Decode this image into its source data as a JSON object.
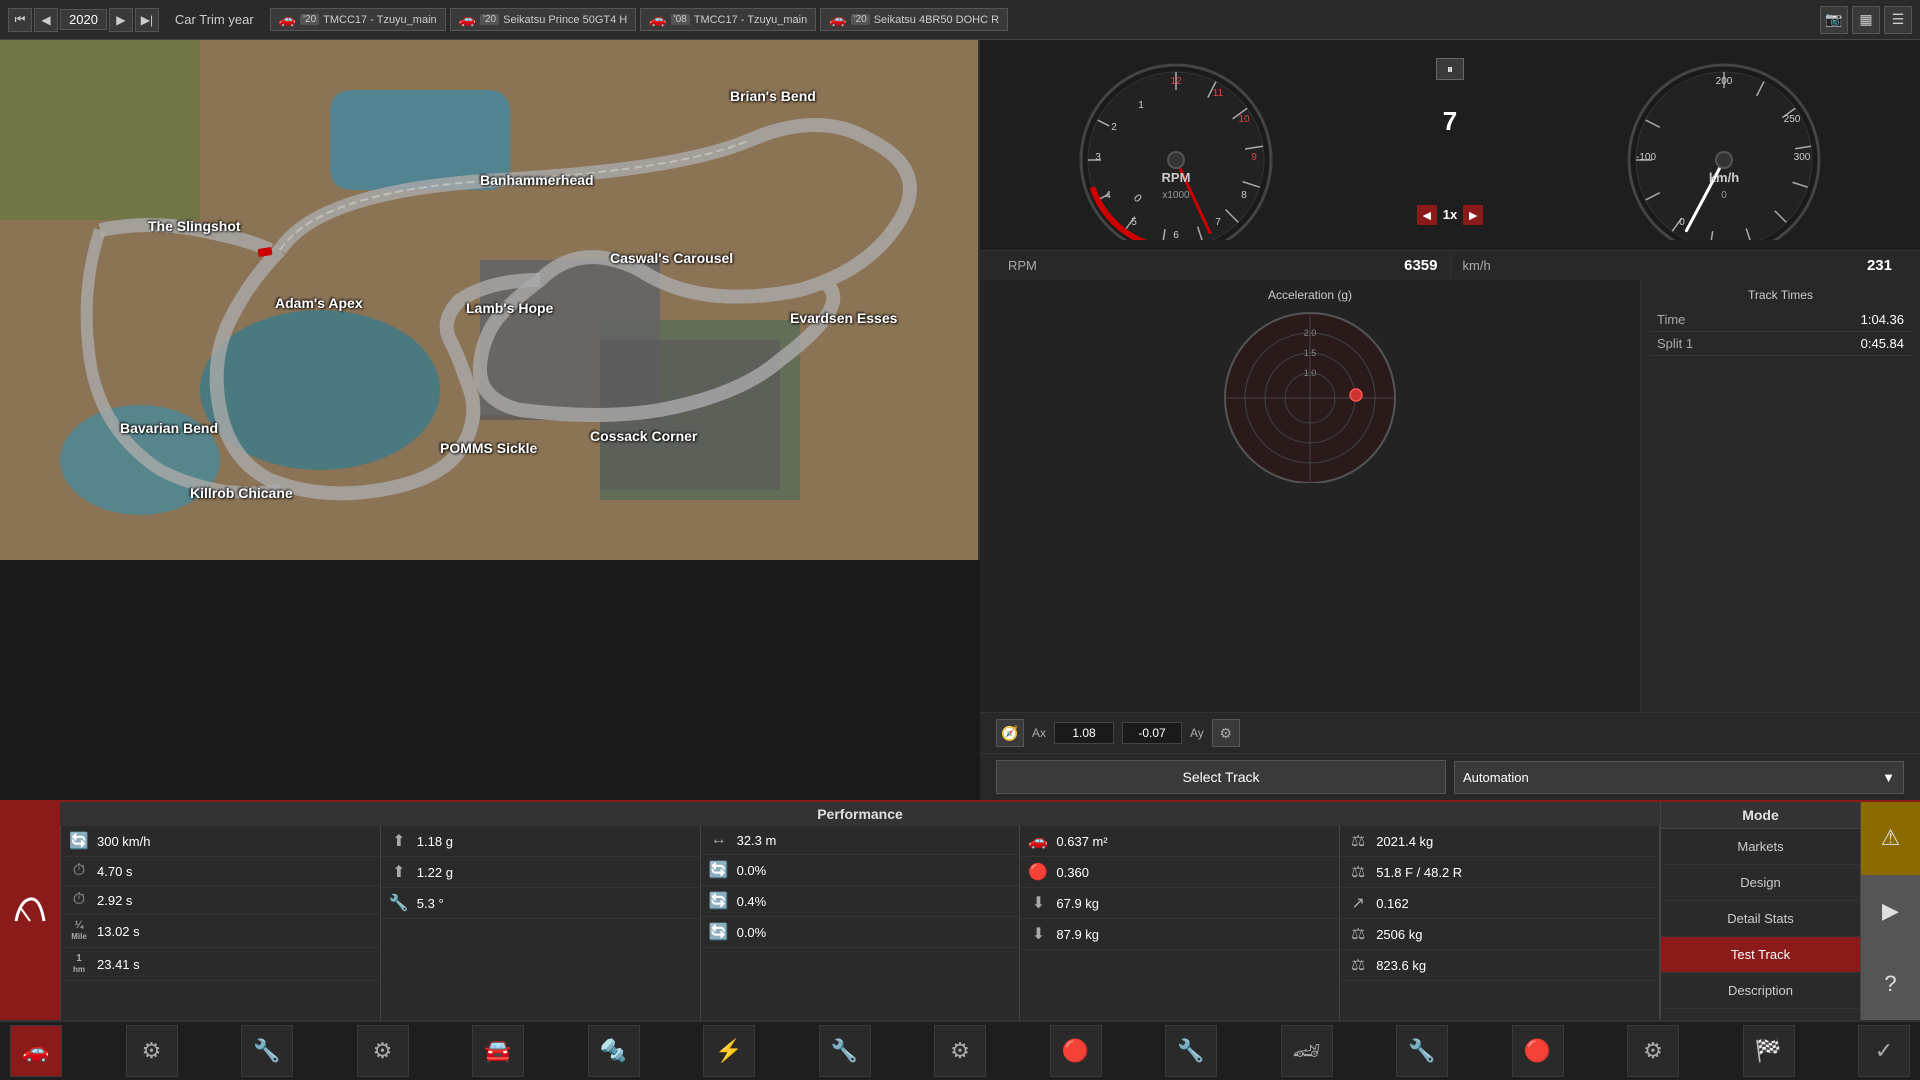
{
  "topbar": {
    "year": "2020",
    "trim_label": "Car Trim year",
    "cars": [
      {
        "icon": "🚗",
        "year": "'20",
        "name": "TMCC17 - Tzuyu_main"
      },
      {
        "icon": "🚗",
        "year": "'20",
        "name": "Seikatsu Prince 50GT4 H"
      },
      {
        "icon": "🚗",
        "year": "'08",
        "name": "TMCC17 - Tzuyu_main"
      },
      {
        "icon": "🚗",
        "year": "'20",
        "name": "Seikatsu 4BR50 DOHC R"
      }
    ]
  },
  "track": {
    "labels": [
      {
        "text": "Brian's Bend",
        "left": "730",
        "top": "48"
      },
      {
        "text": "Banhammerhead",
        "left": "480",
        "top": "132"
      },
      {
        "text": "The Slingshot",
        "left": "148",
        "top": "178"
      },
      {
        "text": "Caswal's Carousel",
        "left": "610",
        "top": "210"
      },
      {
        "text": "Adam's Apex",
        "left": "275",
        "top": "255"
      },
      {
        "text": "Lamb's Hope",
        "left": "466",
        "top": "260"
      },
      {
        "text": "Evardsen Esses",
        "left": "790",
        "top": "270"
      },
      {
        "text": "Cossack Corner",
        "left": "590",
        "top": "388"
      },
      {
        "text": "Bavarian Bend",
        "left": "120",
        "top": "380"
      },
      {
        "text": "POMMS Sickle",
        "left": "440",
        "top": "400"
      },
      {
        "text": "Killrob Chicane",
        "left": "190",
        "top": "445"
      }
    ],
    "car_pos": {
      "left": "258",
      "top": "208"
    }
  },
  "gauges": {
    "rpm_label": "RPM",
    "rpm_unit": "x1000",
    "rpm_value": "6359",
    "kmh_label": "km/h",
    "kmh_value": "231",
    "gear": "7",
    "speed_mult": "1x",
    "pause_icon": "⏸"
  },
  "track_times": {
    "title": "Track Times",
    "rows": [
      {
        "label": "Time",
        "value": "1:04.36"
      },
      {
        "label": "Split 1",
        "value": "0:45.84"
      }
    ]
  },
  "acceleration": {
    "title": "Acceleration (g)",
    "ax_label": "Ax",
    "ax_value": "1.08",
    "ay_label": "Ay",
    "ay_value": "-0.07"
  },
  "select_track": {
    "button_label": "Select Track",
    "dropdown_label": "Automation"
  },
  "performance": {
    "title": "Performance",
    "columns": [
      {
        "rows": [
          {
            "icon": "🔄",
            "value": "300 km/h"
          },
          {
            "icon": "⏱",
            "value": "4.70 s"
          },
          {
            "icon": "⏱",
            "value": "2.92 s"
          },
          {
            "icon": "¼",
            "value": "13.02 s",
            "small": "Mile"
          },
          {
            "icon": "1",
            "value": "23.41 s",
            "small": "hm"
          }
        ]
      },
      {
        "rows": [
          {
            "icon": "⬆",
            "value": "1.18 g"
          },
          {
            "icon": "⬆",
            "value": "1.22 g"
          },
          {
            "icon": "🔧",
            "value": "5.3 °"
          }
        ]
      },
      {
        "rows": [
          {
            "icon": "↔",
            "value": "32.3 m"
          },
          {
            "icon": "🔄",
            "value": "0.0%"
          },
          {
            "icon": "🔄",
            "value": "0.4%"
          },
          {
            "icon": "🔄",
            "value": "0.0%"
          }
        ]
      },
      {
        "rows": [
          {
            "icon": "🚗",
            "value": "0.637 m²"
          },
          {
            "icon": "🔴",
            "value": "0.360"
          },
          {
            "icon": "⬇",
            "value": "67.9 kg"
          },
          {
            "icon": "⬇",
            "value": "87.9 kg"
          }
        ]
      },
      {
        "rows": [
          {
            "icon": "⚖",
            "value": "2021.4 kg"
          },
          {
            "icon": "⚖",
            "value": "51.8 F / 48.2 R"
          },
          {
            "icon": "↗",
            "value": "0.162"
          },
          {
            "icon": "⚖",
            "value": "2506 kg"
          },
          {
            "icon": "⚖",
            "value": "823.6 kg"
          }
        ]
      }
    ]
  },
  "mode": {
    "title": "Mode",
    "buttons": [
      {
        "label": "Markets",
        "active": false
      },
      {
        "label": "Design",
        "active": false
      },
      {
        "label": "Detail Stats",
        "active": false
      },
      {
        "label": "Test Track",
        "active": true
      },
      {
        "label": "Description",
        "active": false
      }
    ]
  },
  "bottom_nav": {
    "icons": [
      "🚗",
      "⚙",
      "🔧",
      "⚙",
      "🚘",
      "🔩",
      "⚡",
      "🔧",
      "⚙",
      "🔴",
      "🔧",
      "🏎",
      "🔧",
      "🔴",
      "⚙",
      "🏁",
      "✓"
    ]
  }
}
